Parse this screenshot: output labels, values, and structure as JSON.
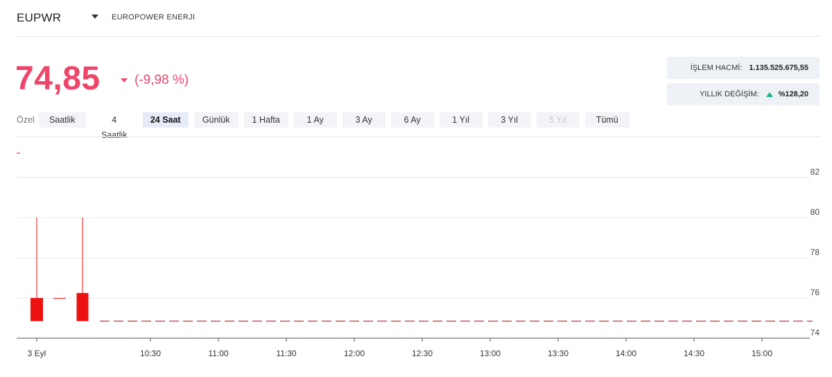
{
  "header": {
    "ticker": "EUPWR",
    "company": "EUROPOWER ENERJI",
    "caret_icon": "caret-down-icon"
  },
  "quote": {
    "price": "74,85",
    "change": "(-9,98 %)",
    "direction_icon": "triangle-down-icon",
    "color": "#f0456a"
  },
  "stats": {
    "volume_label": "İŞLEM HACMİ:",
    "volume_value": "1.135.525.675,55",
    "yearly_label": "YILLIK DEĞİŞİM:",
    "yearly_value": "%128,20",
    "yearly_icon": "triangle-up-icon",
    "yearly_color": "#1ab58a"
  },
  "range": {
    "label": "Özel",
    "tabs": [
      {
        "label": "Saatlik"
      },
      {
        "label": "4 Saatlik"
      },
      {
        "label": "24 Saat",
        "active": true
      },
      {
        "label": "Günlük"
      },
      {
        "label": "1 Hafta"
      },
      {
        "label": "1 Ay"
      },
      {
        "label": "3 Ay"
      },
      {
        "label": "6 Ay"
      },
      {
        "label": "1 Yıl"
      },
      {
        "label": "3 Yıl"
      },
      {
        "label": "5 Yıl",
        "disabled": true
      },
      {
        "label": "Tümü"
      }
    ]
  },
  "chart_data": {
    "type": "candlestick",
    "x_ticks": [
      "3 Eyl",
      "10:30",
      "11:00",
      "11:30",
      "12:00",
      "12:30",
      "13:00",
      "13:30",
      "14:00",
      "14:30",
      "15:00"
    ],
    "y_ticks": [
      74,
      76,
      78,
      80,
      82
    ],
    "ylim": [
      73.8,
      83.9
    ],
    "grid": true,
    "candle_color": "#ee1111",
    "candles": [
      {
        "open": 76.0,
        "high": 80.0,
        "low": 74.85,
        "close": 74.85
      },
      {
        "open": 76.0,
        "high": 76.0,
        "low": 76.0,
        "close": 76.0
      },
      {
        "open": 76.25,
        "high": 80.0,
        "low": 74.85,
        "close": 74.85
      }
    ],
    "flat_line": {
      "value": 74.85,
      "color": "#c0575c"
    }
  }
}
